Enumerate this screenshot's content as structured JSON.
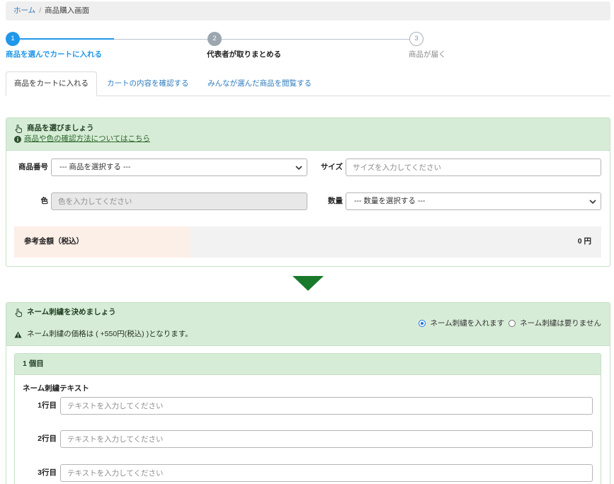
{
  "breadcrumb": {
    "home": "ホーム",
    "separator": "/",
    "current": "商品購入画面"
  },
  "stepper": {
    "steps": [
      {
        "number": "1",
        "label": "商品を選んでカートに入れる",
        "current": true,
        "muted": false
      },
      {
        "number": "2",
        "label": "代表者が取りまとめる",
        "current": false,
        "muted": false
      },
      {
        "number": "3",
        "label": "商品が届く",
        "current": false,
        "muted": true
      }
    ],
    "connectors": [
      {
        "fill": 0.5
      },
      {
        "fill": 0
      }
    ]
  },
  "tabs": [
    {
      "label": "商品をカートに入れる",
      "active": true
    },
    {
      "label": "カートの内容を確認する",
      "active": false
    },
    {
      "label": "みんなが選んだ商品を閲覧する",
      "active": false
    }
  ],
  "select_product_card": {
    "title_icon": "hand-pointer-icon",
    "title": "商品を選びましょう",
    "help_icon": "info-circle-icon",
    "help_link": "商品や色の確認方法についてはこちら",
    "fields": {
      "product_number": {
        "label": "商品番号",
        "selected": "--- 商品を選択する ---"
      },
      "size": {
        "label": "サイズ",
        "placeholder": "サイズを入力してください"
      },
      "color": {
        "label": "色",
        "placeholder": "色を入力してください",
        "disabled": true
      },
      "quantity": {
        "label": "数量",
        "selected": "--- 数量を選択する ---"
      }
    },
    "price": {
      "label": "参考金額（税込）",
      "value": "0 円"
    }
  },
  "next_arrow_icon": "down-triangle-icon",
  "embroidery_card": {
    "title_icon": "hand-pointer-icon",
    "title": "ネーム刺繍を決めましょう",
    "notice_icon": "warning-triangle-icon",
    "price_notice": "ネーム刺繍の価格は ( +550円(税込) )となります。",
    "options": [
      {
        "label": "ネーム刺繍を入れます",
        "checked": true
      },
      {
        "label": "ネーム刺繍は要りません",
        "checked": false
      }
    ],
    "items": [
      {
        "title": "1 個目",
        "text_heading": "ネーム刺繍テキスト",
        "lines": [
          {
            "label": "1行目",
            "placeholder": "テキストを入力してください"
          },
          {
            "label": "2行目",
            "placeholder": "テキストを入力してください"
          },
          {
            "label": "3行目",
            "placeholder": "テキストを入力してください"
          }
        ]
      }
    ]
  },
  "colors": {
    "link": "#2f7bbd",
    "step_active": "#1f97ea",
    "step_inactive": "#9ba6ae",
    "card_header": "#d7ecd7",
    "card_border": "#c5dfc5",
    "price_label_bg": "#fcefe8",
    "price_value_bg": "#f2f2f2",
    "arrow": "#1a7a2c"
  }
}
